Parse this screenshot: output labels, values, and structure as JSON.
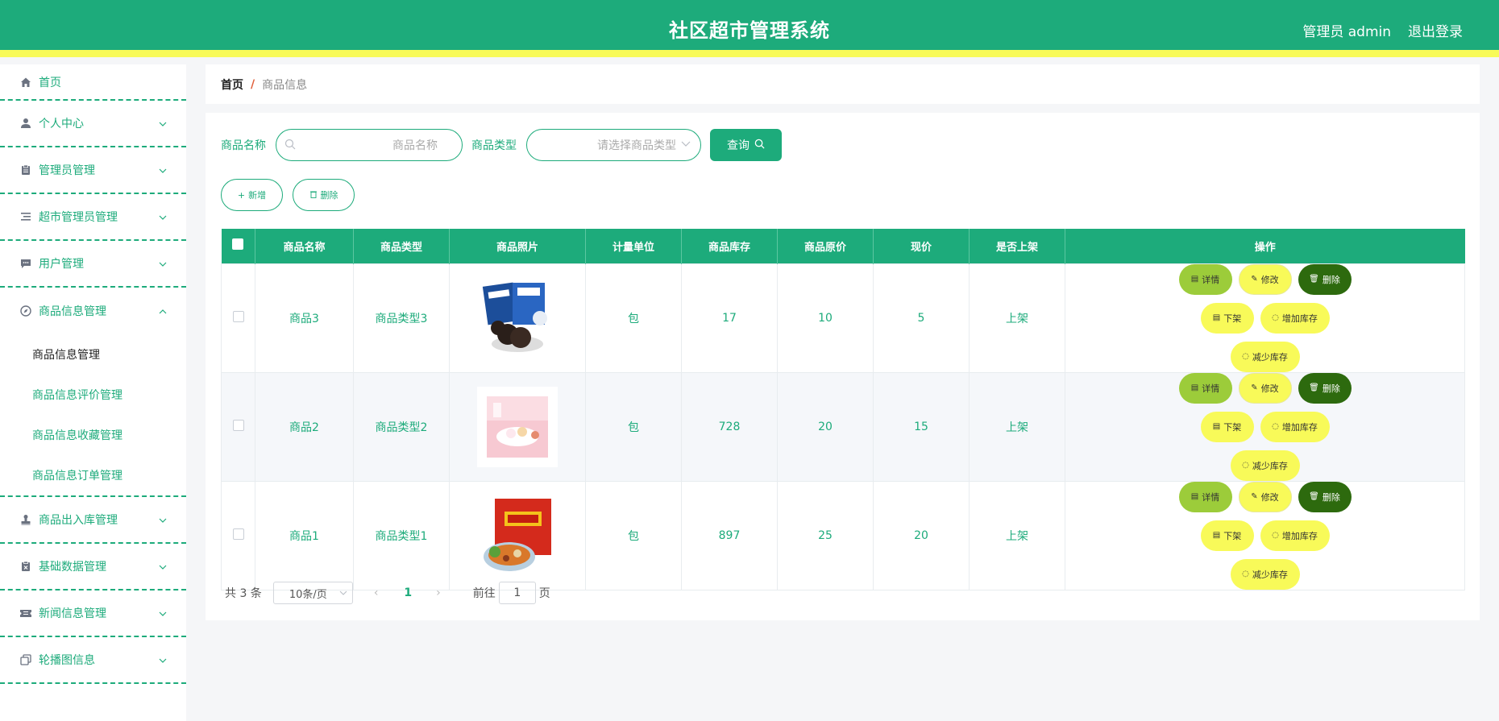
{
  "header": {
    "title": "社区超市管理系统",
    "user": "管理员 admin",
    "logout": "退出登录"
  },
  "sidebar": {
    "items": [
      {
        "label": "首页",
        "icon": "home-icon"
      },
      {
        "label": "个人中心",
        "icon": "user-icon"
      },
      {
        "label": "管理员管理",
        "icon": "clipboard-icon"
      },
      {
        "label": "超市管理员管理",
        "icon": "list-icon"
      },
      {
        "label": "用户管理",
        "icon": "chat-icon"
      },
      {
        "label": "商品信息管理",
        "icon": "compass-icon"
      },
      {
        "label": "商品出入库管理",
        "icon": "stamp-icon"
      },
      {
        "label": "基础数据管理",
        "icon": "delete-box-icon"
      },
      {
        "label": "新闻信息管理",
        "icon": "ticket-icon"
      },
      {
        "label": "轮播图信息",
        "icon": "copy-icon"
      }
    ],
    "submenu": [
      "商品信息管理",
      "商品信息评价管理",
      "商品信息收藏管理",
      "商品信息订单管理"
    ]
  },
  "breadcrumb": {
    "home": "首页",
    "sep": "/",
    "current": "商品信息"
  },
  "search": {
    "name_label": "商品名称",
    "name_placeholder": "商品名称",
    "type_label": "商品类型",
    "type_placeholder": "请选择商品类型",
    "query": "查询"
  },
  "actions": {
    "add": "新增",
    "delete": "删除"
  },
  "table": {
    "headers": [
      "商品名称",
      "商品类型",
      "商品照片",
      "计量单位",
      "商品库存",
      "商品原价",
      "现价",
      "是否上架",
      "操作"
    ],
    "rows": [
      {
        "name": "商品3",
        "type": "商品类型3",
        "unit": "包",
        "stock": "17",
        "orig": "10",
        "price": "5",
        "status": "上架",
        "photo": "cookies"
      },
      {
        "name": "商品2",
        "type": "商品类型2",
        "unit": "包",
        "stock": "728",
        "orig": "20",
        "price": "15",
        "status": "上架",
        "photo": "dessert"
      },
      {
        "name": "商品1",
        "type": "商品类型1",
        "unit": "包",
        "stock": "897",
        "orig": "25",
        "price": "20",
        "status": "上架",
        "photo": "noodles"
      }
    ],
    "ops": {
      "detail": "详情",
      "edit": "修改",
      "remove": "删除",
      "off": "下架",
      "inc": "增加库存",
      "dec": "减少库存"
    }
  },
  "pager": {
    "total": "共 3 条",
    "size": "10条/页",
    "page": "1",
    "goto": "前往",
    "jump": "1",
    "suffix": "页"
  },
  "colors": {
    "primary": "#1dab7b",
    "yellow": "#f8fa59",
    "lime": "#9ccc3a",
    "dark": "#2d6a0e"
  }
}
